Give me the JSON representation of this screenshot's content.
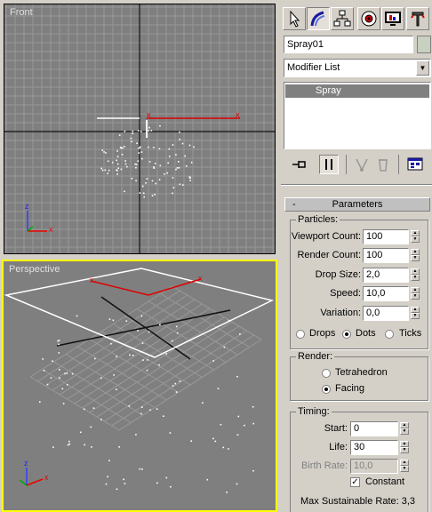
{
  "viewports": {
    "front": {
      "label": "Front",
      "axis_z": "z",
      "axis_x": "x"
    },
    "perspective": {
      "label": "Perspective",
      "axis_z": "z",
      "axis_x": "x"
    }
  },
  "command_panel": {
    "tabs": [
      "create-icon",
      "modify-icon",
      "hierarchy-icon",
      "motion-icon",
      "display-icon",
      "utilities-icon"
    ],
    "object_name": "Spray01",
    "object_color": "#c8d0c0",
    "modifier_list": "Modifier List",
    "stack_items": [
      "Spray"
    ],
    "stack_tools": [
      "pin-stack-icon",
      "show-end-result-icon",
      "make-unique-icon",
      "remove-modifier-icon",
      "configure-sets-icon"
    ]
  },
  "parameters": {
    "rollout_toggle": "-",
    "rollout_title": "Parameters",
    "particles": {
      "title": "Particles:",
      "viewport_count_label": "Viewport Count:",
      "viewport_count": "100",
      "render_count_label": "Render Count:",
      "render_count": "100",
      "drop_size_label": "Drop Size:",
      "drop_size": "2,0",
      "speed_label": "Speed:",
      "speed": "10,0",
      "variation_label": "Variation:",
      "variation": "0,0",
      "display_options": [
        "Drops",
        "Dots",
        "Ticks"
      ],
      "display_selected": "Dots"
    },
    "render": {
      "title": "Render:",
      "options": [
        "Tetrahedron",
        "Facing"
      ],
      "selected": "Facing"
    },
    "timing": {
      "title": "Timing:",
      "start_label": "Start:",
      "start": "0",
      "life_label": "Life:",
      "life": "30",
      "birth_rate_label": "Birth Rate:",
      "birth_rate": "10,0",
      "constant_label": "Constant",
      "constant_checked": true,
      "max_rate_label": "Max Sustainable Rate: 3,3"
    }
  },
  "colors": {
    "viewport_bg": "#7f7f7f",
    "active_border": "#ffff00",
    "gizmo": "#e00000",
    "selected_stack": "#808080"
  }
}
